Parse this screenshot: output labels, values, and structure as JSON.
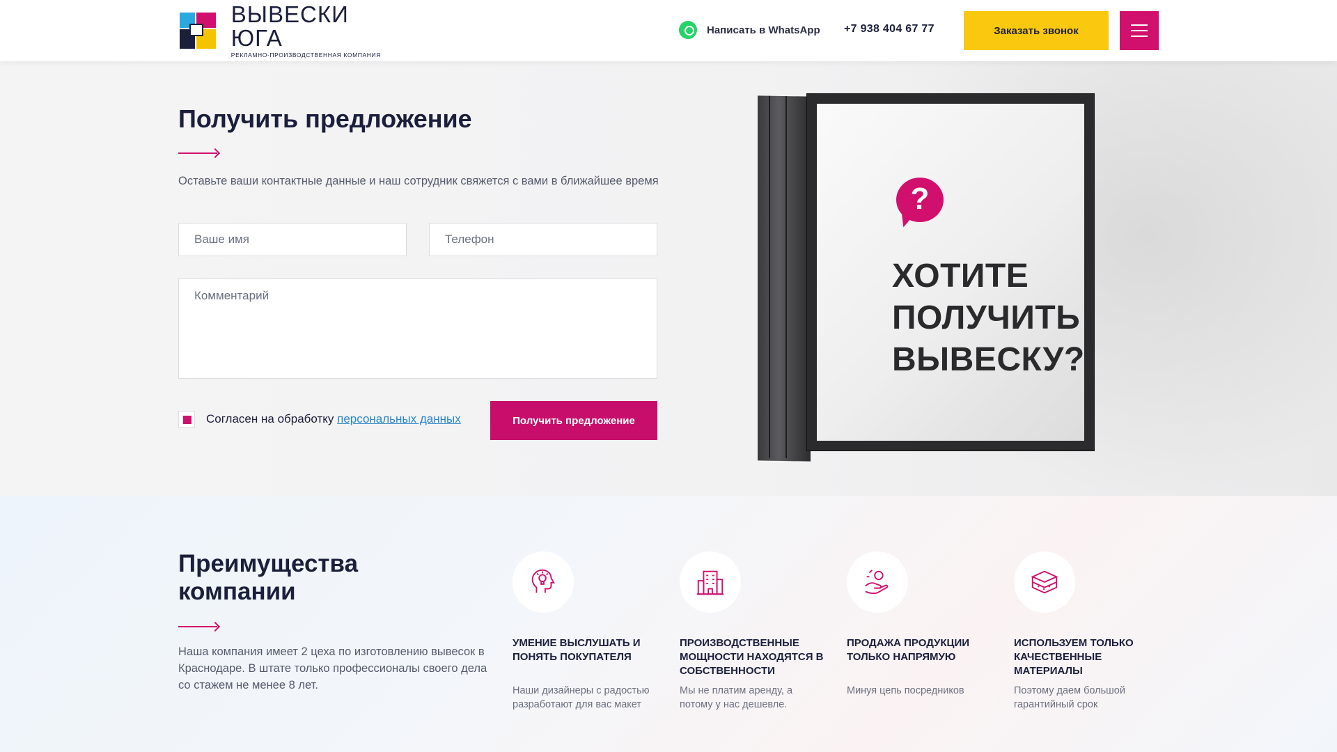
{
  "header": {
    "logo_title": "ВЫВЕСКИ ЮГА",
    "logo_subtitle": "РЕКЛАМНО-ПРОИЗВОДСТВЕННАЯ КОМПАНИЯ",
    "whatsapp_label": "Написать в WhatsApp",
    "phone": "+7 938 404 67 77",
    "callback_label": "Заказать звонок"
  },
  "offer_form": {
    "title": "Получить предложение",
    "description": "Оставьте ваши контактные данные и наш сотрудник свяжется с вами в ближайшее время",
    "name_placeholder": "Ваше имя",
    "phone_placeholder": "Телефон",
    "comment_placeholder": "Комментарий",
    "consent_text": "Согласен на обработку",
    "consent_link": "персональных данных",
    "submit_label": "Получить предложение"
  },
  "sign": {
    "question_mark": "?",
    "line1": "ХОТИТЕ",
    "line2": "ПОЛУЧИТЬ",
    "line3": "ВЫВЕСКУ?"
  },
  "advantages": {
    "title": "Преимущества компании",
    "description": "Наша компания имеет 2 цеха по изготовлению вывесок в Краснодаре. В штате только профессионалы своего дела со стажем не менее 8 лет.",
    "items": [
      {
        "icon": "idea-head-icon",
        "title": "Умение выслушать и понять покупателя",
        "text": "Наши дизайнеры с радостью разработают для вас макет"
      },
      {
        "icon": "building-icon",
        "title": "Производственные мощности находятся в собственности",
        "text": "Мы не платим аренду, а потому у нас дешевле."
      },
      {
        "icon": "hand-money-icon",
        "title": "Продажа продукции только напрямую",
        "text": "Минуя цепь посредников"
      },
      {
        "icon": "material-layers-icon",
        "title": "Используем только качественные материалы",
        "text": "Поэтому даем большой гарантийный срок"
      }
    ]
  },
  "colors": {
    "accent": "#d1106e",
    "yellow": "#f9c80f",
    "dark": "#1b1f3b",
    "link": "#2a86c8"
  }
}
